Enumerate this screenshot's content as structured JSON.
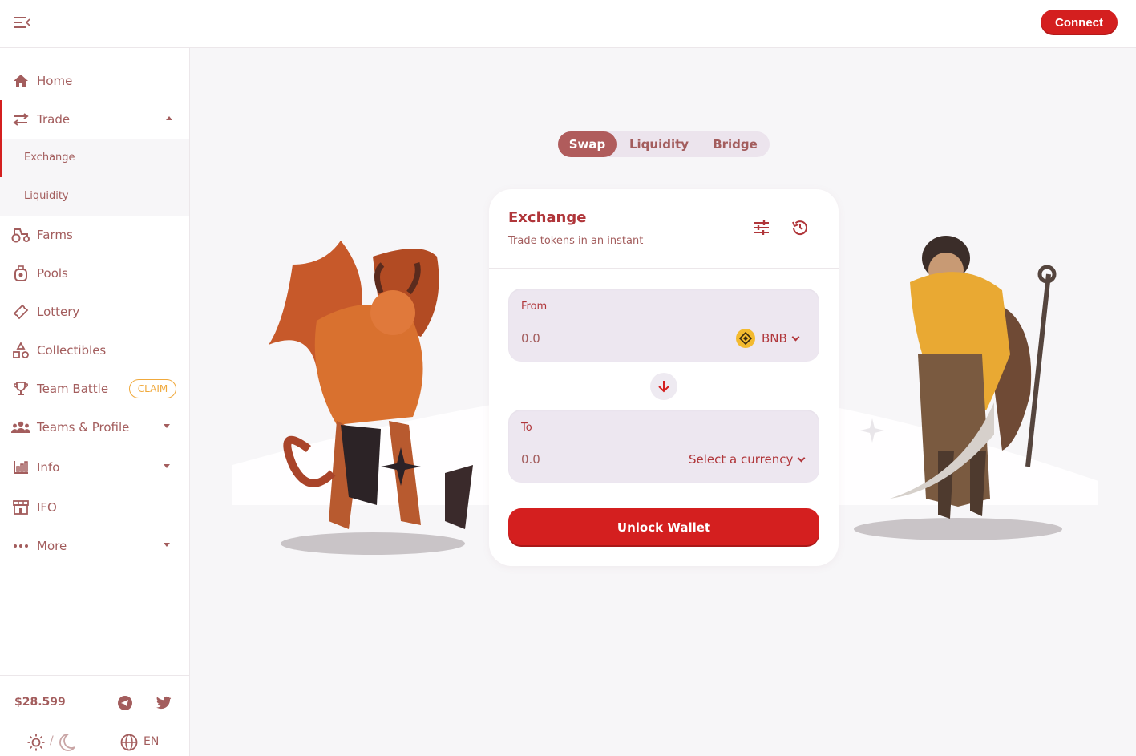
{
  "header": {
    "connect_label": "Connect"
  },
  "sidebar": {
    "items": [
      {
        "label": "Home",
        "icon": "home-icon"
      },
      {
        "label": "Trade",
        "icon": "arrows-swap-icon",
        "expanded": true
      },
      {
        "label": "Farms",
        "icon": "tractor-icon"
      },
      {
        "label": "Pools",
        "icon": "pool-icon"
      },
      {
        "label": "Lottery",
        "icon": "ticket-icon"
      },
      {
        "label": "Collectibles",
        "icon": "shapes-icon"
      },
      {
        "label": "Team Battle",
        "icon": "trophy-icon",
        "badge": "CLAIM"
      },
      {
        "label": "Teams & Profile",
        "icon": "people-icon"
      },
      {
        "label": "Info",
        "icon": "chart-icon"
      },
      {
        "label": "IFO",
        "icon": "store-icon"
      },
      {
        "label": "More",
        "icon": "more-dots-icon"
      }
    ],
    "trade_sub": [
      {
        "label": "Exchange",
        "active": true
      },
      {
        "label": "Liquidity"
      }
    ],
    "footer": {
      "price": "$28.599",
      "theme_separator": "/",
      "language": "EN"
    }
  },
  "tabs": [
    {
      "label": "Swap",
      "active": true
    },
    {
      "label": "Liquidity"
    },
    {
      "label": "Bridge"
    }
  ],
  "exchange": {
    "title": "Exchange",
    "subtitle": "Trade tokens in an instant",
    "from": {
      "label": "From",
      "placeholder": "0.0",
      "currency": "BNB"
    },
    "to": {
      "label": "To",
      "placeholder": "0.0",
      "currency": "Select a currency"
    },
    "unlock_label": "Unlock Wallet"
  },
  "colors": {
    "accent": "#d41f1f",
    "text": "#a35d5d",
    "title": "#b0363a",
    "tab_active": "#b05c5c",
    "panel": "#ede7f0",
    "claim": "#f0a93c"
  }
}
